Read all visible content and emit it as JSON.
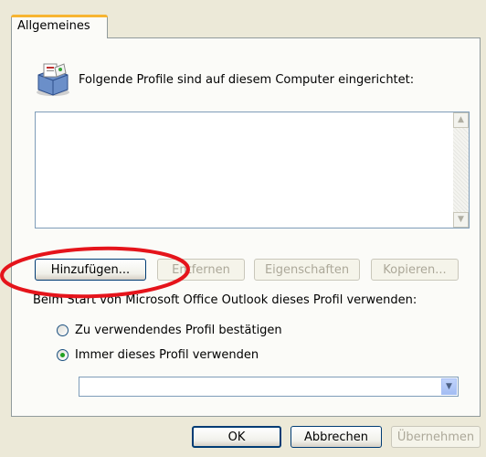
{
  "tabs": [
    {
      "label": "Allgemeines"
    }
  ],
  "header": {
    "text": "Folgende Profile sind auf diesem Computer eingerichtet:"
  },
  "buttons": {
    "add": "Hinzufügen...",
    "remove": "Entfernen",
    "properties": "Eigenschaften",
    "copy": "Kopieren..."
  },
  "startup": {
    "label": "Beim Start von Microsoft Office Outlook dieses Profil verwenden:",
    "options": [
      {
        "label": "Zu verwendendes Profil bestätigen",
        "checked": false
      },
      {
        "label": "Immer dieses Profil verwenden",
        "checked": true
      }
    ],
    "profile_select_value": ""
  },
  "footer": {
    "ok": "OK",
    "cancel": "Abbrechen",
    "apply": "Übernehmen"
  },
  "annotation": {
    "color": "#e5141b"
  }
}
